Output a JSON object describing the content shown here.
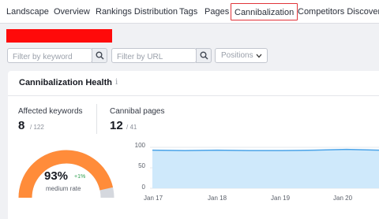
{
  "tabs": [
    {
      "label": "Landscape",
      "active": false
    },
    {
      "label": "Overview",
      "active": false
    },
    {
      "label": "Rankings Distribution",
      "active": false
    },
    {
      "label": "Tags",
      "active": false
    },
    {
      "label": "Pages",
      "active": false
    },
    {
      "label": "Cannibalization",
      "active": true
    },
    {
      "label": "Competitors Discovery",
      "active": false
    }
  ],
  "filters": {
    "keyword_placeholder": "Filter by keyword",
    "url_placeholder": "Filter by URL",
    "positions_label": "Positions"
  },
  "card": {
    "title": "Cannibalization Health",
    "info_icon": "i"
  },
  "metrics": {
    "affected_label": "Affected keywords",
    "affected_value": "8",
    "affected_total": "/ 122",
    "pages_label": "Cannibal pages",
    "pages_value": "12",
    "pages_total": "/ 41"
  },
  "gauge": {
    "percent_text": "93%",
    "percent": 93,
    "delta": "+1%",
    "label": "medium rate",
    "color": "#ff8c3a",
    "track_color": "#d5d8de"
  },
  "chart_data": {
    "type": "area",
    "x": [
      "Jan 17",
      "Jan 18",
      "Jan 19",
      "Jan 20"
    ],
    "xticks": [
      "Jan 17",
      "Jan 18",
      "Jan 19",
      "Jan 20"
    ],
    "y": [
      93,
      92,
      93,
      92,
      92,
      93,
      95,
      93
    ],
    "yticks": [
      "100",
      "50",
      "0"
    ],
    "ylim": [
      0,
      100
    ],
    "line_color": "#4aa3e8",
    "fill_color": "#cfe9fb"
  },
  "colors": {
    "active_tab_border": "#e0343a",
    "redacted": "#ff0a0a"
  }
}
